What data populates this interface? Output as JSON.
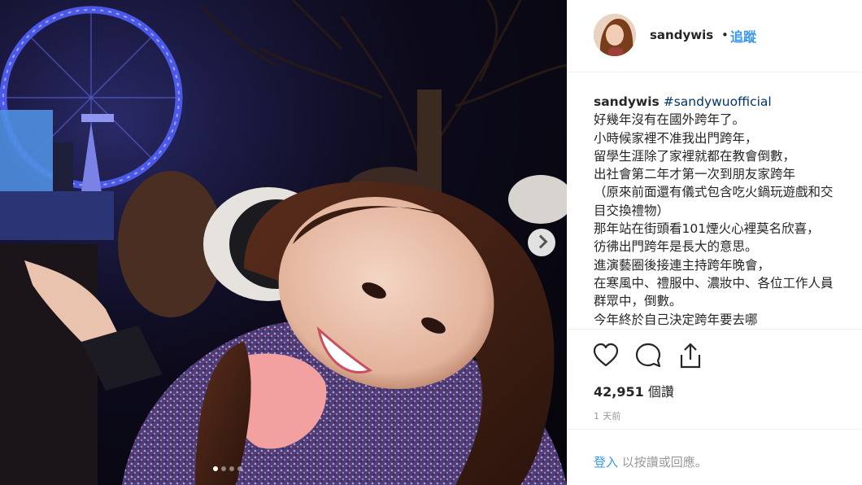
{
  "post": {
    "username": "sandywis",
    "follow_label": "追蹤",
    "separator": "•",
    "caption_username": "sandywis",
    "hashtag": "#sandywuofficial",
    "caption_lines": [
      "好幾年沒有在國外跨年了。",
      "小時候家裡不准我出門跨年，",
      "留學生涯除了家裡就都在教會倒數，",
      "出社會第二年才第一次到朋友家跨年",
      "（原來前面還有儀式包含吃火鍋玩遊戲和交",
      "目交換禮物）",
      "那年站在街頭看101煙火心裡莫名欣喜，",
      "彷彿出門跨年是長大的意思。",
      "進演藝圈後接連主持跨年晚會，",
      "在寒風中、禮服中、濃妝中、各位工作人員",
      "群眾中，倒數。",
      "今年終於自己決定跨年要去哪"
    ],
    "likes_count": "42,951",
    "likes_label": "個讚",
    "timestamp": "1 天前",
    "login_link": "登入",
    "login_text": "以按讚或回應。"
  },
  "carousel": {
    "total": 4,
    "active": 0
  },
  "icons": {
    "like": "heart-icon",
    "comment": "comment-icon",
    "share": "share-icon",
    "next": "chevron-right-icon"
  },
  "colors": {
    "link": "#3897f0",
    "text": "#262626",
    "muted": "#999999",
    "hashtag": "#003569"
  }
}
